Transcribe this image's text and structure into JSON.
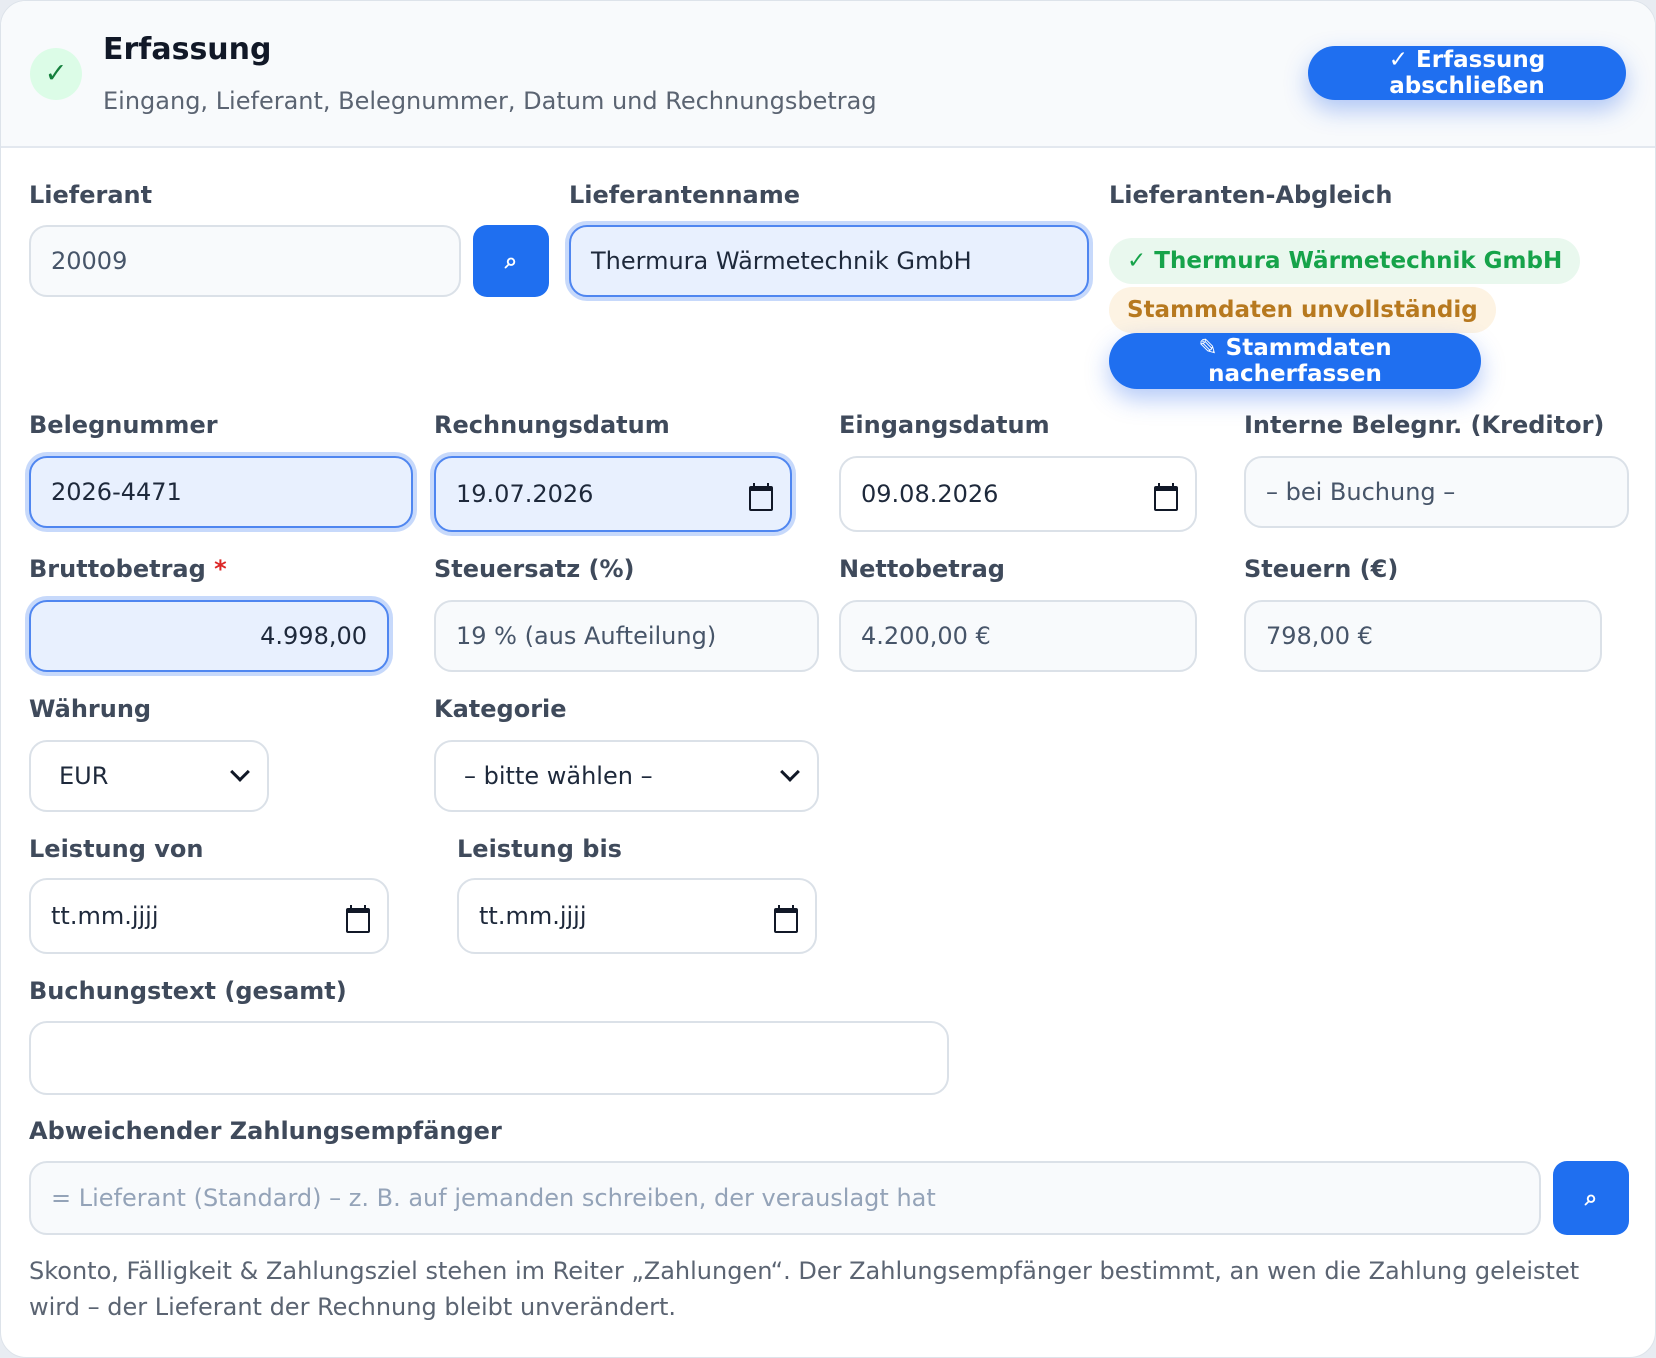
{
  "header": {
    "title": "Erfassung",
    "subtitle": "Eingang, Lieferant, Belegnummer, Datum und Rechnungsbetrag",
    "status_icon": "✓",
    "finish_button": "✓ Erfassung abschließen"
  },
  "lieferant": {
    "label": "Lieferant",
    "value": "20009",
    "search_icon": "⌕"
  },
  "lieferantenname": {
    "label": "Lieferantenname",
    "value": "Thermura Wärmetechnik GmbH"
  },
  "abgleich": {
    "label": "Lieferanten-Abgleich",
    "match_badge": "✓ Thermura Wärmetechnik GmbH",
    "warning_badge": "Stammdaten unvollständig",
    "button": "✎ Stammdaten nacherfassen"
  },
  "belegnummer": {
    "label": "Belegnummer",
    "value": "2026-4471"
  },
  "rechnungsdatum": {
    "label": "Rechnungsdatum",
    "value": "19.07.2026"
  },
  "eingangsdatum": {
    "label": "Eingangsdatum",
    "value": "09.08.2026"
  },
  "interne_belegnr": {
    "label": "Interne Belegnr. (Kreditor)",
    "value": "– bei Buchung –"
  },
  "bruttobetrag": {
    "label": "Bruttobetrag",
    "required_mark": "*",
    "value": "4.998,00"
  },
  "steuersatz": {
    "label": "Steuersatz (%)",
    "value": "19 % (aus Aufteilung)"
  },
  "nettobetrag": {
    "label": "Nettobetrag",
    "value": "4.200,00 €"
  },
  "steuern": {
    "label": "Steuern (€)",
    "value": "798,00 €"
  },
  "waehrung": {
    "label": "Währung",
    "value": "EUR"
  },
  "kategorie": {
    "label": "Kategorie",
    "value": "– bitte wählen –"
  },
  "leistung_von": {
    "label": "Leistung von",
    "placeholder": "tt.mm.jjjj"
  },
  "leistung_bis": {
    "label": "Leistung bis",
    "placeholder": "tt.mm.jjjj"
  },
  "buchungstext": {
    "label": "Buchungstext (gesamt)",
    "value": ""
  },
  "zahlungsempfaenger": {
    "label": "Abweichender Zahlungsempfänger",
    "placeholder": "= Lieferant (Standard) – z. B. auf jemanden schreiben, der verauslagt hat",
    "search_icon": "⌕"
  },
  "hint": "Skonto, Fälligkeit & Zahlungsziel stehen im Reiter „Zahlungen“. Der Zahlungsempfänger bestimmt, an wen die Zahlung geleistet wird – der Lieferant der Rechnung bleibt unverändert.",
  "colors": {
    "primary": "#1f6ff0",
    "success": "#16a34a",
    "warning": "#b7791f",
    "required": "#dc2626"
  }
}
